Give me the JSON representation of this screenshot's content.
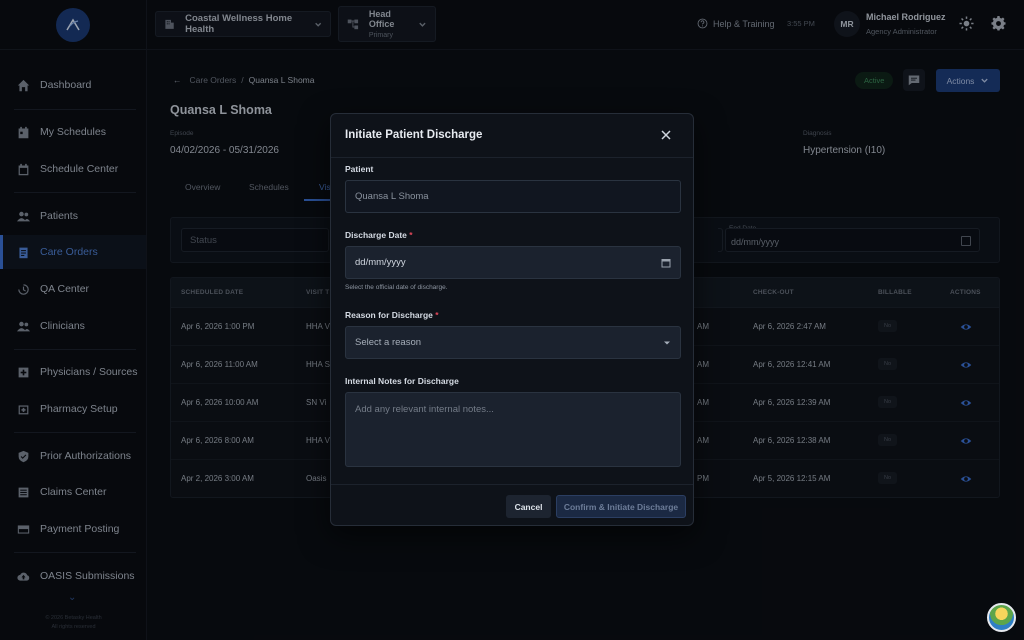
{
  "header": {
    "agency": "Coastal Wellness Home Health",
    "office_name": "Head Office",
    "office_sub": "Primary",
    "help": "Help & Training",
    "time": "3:55 PM",
    "user_initials": "MR",
    "user_name": "Michael Rodriguez",
    "user_role": "Agency Administrator"
  },
  "sidebar": {
    "items": [
      {
        "label": "Dashboard",
        "icon": "home-icon"
      },
      {
        "label": "My Schedules",
        "icon": "calendar-icon"
      },
      {
        "label": "Schedule Center",
        "icon": "calendar-icon"
      },
      {
        "label": "Patients",
        "icon": "users-icon"
      },
      {
        "label": "Care Orders",
        "icon": "clipboard-icon",
        "active": true
      },
      {
        "label": "QA Center",
        "icon": "history-icon"
      },
      {
        "label": "Clinicians",
        "icon": "users-icon"
      },
      {
        "label": "Physicians / Sources",
        "icon": "plus-square-icon"
      },
      {
        "label": "Pharmacy Setup",
        "icon": "pharmacy-icon"
      },
      {
        "label": "Prior Authorizations",
        "icon": "shield-icon"
      },
      {
        "label": "Claims Center",
        "icon": "list-icon"
      },
      {
        "label": "Payment Posting",
        "icon": "card-icon"
      },
      {
        "label": "OASIS Submissions",
        "icon": "cloud-upload-icon"
      }
    ],
    "footer_line1": "© 2026 Betasky Health",
    "footer_line2": "All rights reserved"
  },
  "page": {
    "breadcrumb_parent": "Care Orders",
    "breadcrumb_sep": "/",
    "breadcrumb_current": "Quansa L Shoma",
    "title": "Quansa L Shoma",
    "status": "Active",
    "actions_label": "Actions",
    "episode_label": "Episode",
    "episode_value": "04/02/2026 - 05/31/2026",
    "diagnosis_label": "Diagnosis",
    "diagnosis_value": "Hypertension (I10)",
    "tabs": [
      "Overview",
      "Schedules",
      "Vis"
    ],
    "filter_status_placeholder": "Status",
    "end_date_label": "End Date",
    "end_date_placeholder": "dd/mm/yyyy"
  },
  "table": {
    "headers": {
      "scheduled": "SCHEDULED DATE",
      "visit": "VISIT T",
      "checkout": "CHECK-OUT",
      "billable": "BILLABLE",
      "actions": "ACTIONS"
    },
    "rows": [
      {
        "scheduled": "Apr 6, 2026 1:00 PM",
        "visit": "HHA V",
        "checkin_tail": "AM",
        "checkout": "Apr 6, 2026 2:47 AM",
        "billable": "No"
      },
      {
        "scheduled": "Apr 6, 2026 11:00 AM",
        "visit": "HHA S",
        "checkin_tail": "AM",
        "checkout": "Apr 6, 2026 12:41 AM",
        "billable": "No"
      },
      {
        "scheduled": "Apr 6, 2026 10:00 AM",
        "visit": "SN Vi",
        "checkin_tail": "AM",
        "checkout": "Apr 6, 2026 12:39 AM",
        "billable": "No"
      },
      {
        "scheduled": "Apr 6, 2026 8:00 AM",
        "visit": "HHA V",
        "checkin_tail": "AM",
        "checkout": "Apr 6, 2026 12:38 AM",
        "billable": "No"
      },
      {
        "scheduled": "Apr 2, 2026 3:00 AM",
        "visit": "Oasis",
        "checkin_tail": "PM",
        "checkout": "Apr 5, 2026 12:15 AM",
        "billable": "No"
      }
    ]
  },
  "modal": {
    "title": "Initiate Patient Discharge",
    "patient_label": "Patient",
    "patient_value": "Quansa L Shoma",
    "discharge_date_label": "Discharge Date",
    "required_mark": "*",
    "discharge_date_placeholder": "dd/mm/yyyy",
    "discharge_date_help": "Select the official date of discharge.",
    "reason_label": "Reason for Discharge",
    "reason_placeholder": "Select a reason",
    "notes_label": "Internal Notes for Discharge",
    "notes_placeholder": "Add any relevant internal notes...",
    "cancel": "Cancel",
    "confirm": "Confirm & Initiate Discharge"
  },
  "colors": {
    "accent": "#3b6fd0",
    "required": "#e0485a",
    "active_badge": "#3d8a5c"
  }
}
